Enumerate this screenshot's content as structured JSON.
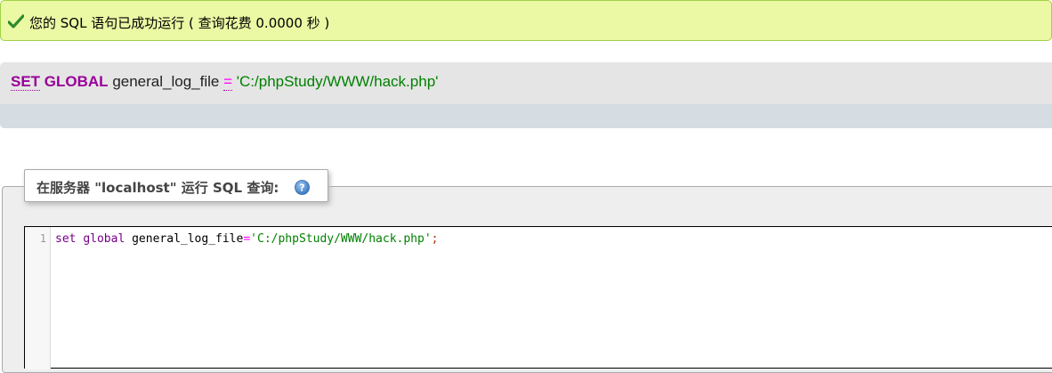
{
  "success_message": "您的 SQL 语句已成功运行 ( 查询花费 0.0000 秒 )",
  "executed_query": {
    "kw_set": "SET",
    "kw_global": "GLOBAL",
    "variable": "general_log_file",
    "operator": "=",
    "value": "'C:/phpStudy/WWW/hack.php'"
  },
  "query_panel": {
    "legend": "在服务器 \"localhost\" 运行 SQL 查询:",
    "help_icon": "help-icon"
  },
  "editor": {
    "line_number": "1",
    "kw_set": "set",
    "kw_global": "global",
    "variable": "general_log_file",
    "operator": "=",
    "value": "'C:/phpStudy/WWW/hack.php'",
    "terminator": ";"
  },
  "colors": {
    "success_bg": "#ebf8a4",
    "keyword": "#990099",
    "string": "#008000",
    "operator": "#ff00ff"
  }
}
